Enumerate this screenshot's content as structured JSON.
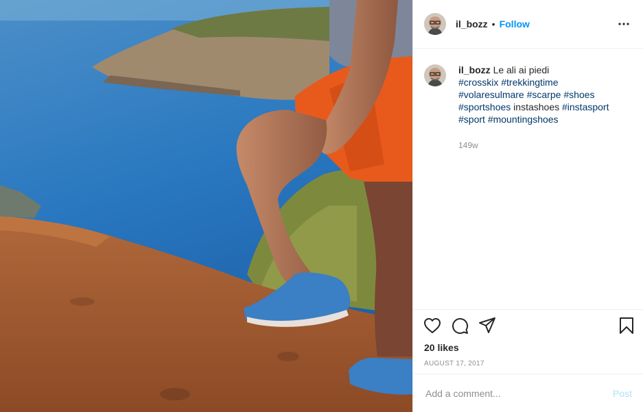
{
  "post": {
    "username": "il_bozz",
    "follow_label": "Follow",
    "separator": "•",
    "caption": {
      "text": "Le ali ai piedi",
      "hashtags_line1": [
        "#crosskix",
        "#trekkingtime"
      ],
      "hashtags_line2": [
        "#volaresulmare",
        "#scarpe",
        "#shoes"
      ],
      "hashtags_line3a": "#sportshoes",
      "plain_word": "instashoes",
      "hashtags_line3b": "#instasport",
      "hashtags_line4": [
        "#sport",
        "#mountingshoes"
      ]
    },
    "time_ago": "149w",
    "likes": "20 likes",
    "date": "AUGUST 17, 2017",
    "comment_placeholder": "Add a comment...",
    "post_button": "Post"
  },
  "icons": {
    "more": "more-options-icon",
    "like": "heart-icon",
    "comment": "comment-icon",
    "share": "share-icon",
    "save": "bookmark-icon"
  },
  "colors": {
    "link_blue": "#0095f6",
    "hashtag": "#00376b",
    "muted": "#8e8e8e",
    "post_disabled": "#b2dffc"
  }
}
